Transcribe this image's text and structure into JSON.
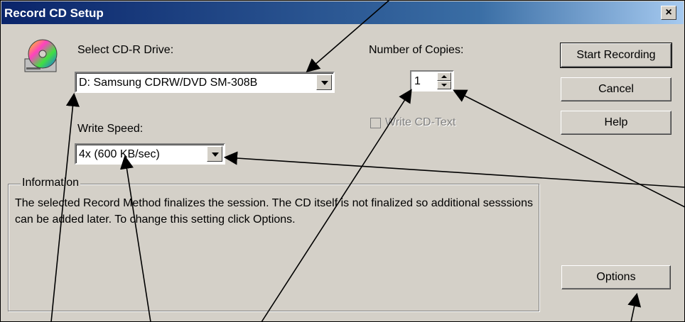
{
  "window": {
    "title": "Record CD Setup",
    "close_glyph": "✕"
  },
  "drive": {
    "label": "Select CD-R Drive:",
    "value": "D: Samsung CDRW/DVD SM-308B"
  },
  "speed": {
    "label": "Write Speed:",
    "value": "4x (600 KB/sec)"
  },
  "copies": {
    "label": "Number of Copies:",
    "value": "1"
  },
  "cdtext": {
    "label": "Write CD-Text",
    "checked": false,
    "enabled": false
  },
  "buttons": {
    "start": "Start Recording",
    "cancel": "Cancel",
    "help": "Help",
    "options": "Options"
  },
  "information": {
    "title": "Information",
    "text": "The selected Record Method finalizes the session. The CD itself is not finalized so additional sesssions can be added later. To change this setting click Options."
  },
  "icons": {
    "cd": "cd-drive-icon",
    "dropdown": "chevron-down-icon",
    "spinner": "spinner-arrows-icon"
  }
}
